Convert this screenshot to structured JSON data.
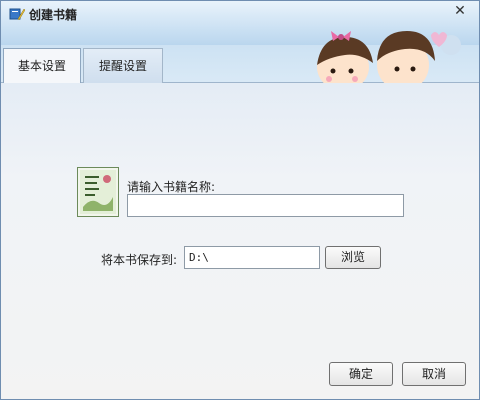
{
  "window": {
    "title": "创建书籍",
    "close_glyph": "✕"
  },
  "tabs": [
    {
      "label": "基本设置",
      "active": true
    },
    {
      "label": "提醒设置",
      "active": false
    }
  ],
  "form": {
    "name_label": "请输入书籍名称:",
    "name_value": "",
    "save_label": "将本书保存到:",
    "save_path": "D:\\",
    "browse_label": "浏览"
  },
  "footer": {
    "ok_label": "确定",
    "cancel_label": "取消"
  },
  "colors": {
    "title_bar": "#cfe3f4",
    "accent_heart": "#e86aa5"
  }
}
